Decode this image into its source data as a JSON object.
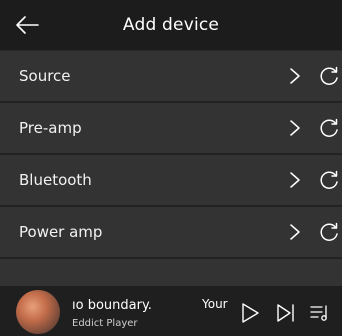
{
  "header": {
    "title": "Add device",
    "back_icon": "arrow-left-icon"
  },
  "devices": [
    {
      "label": "Source"
    },
    {
      "label": "Pre-amp"
    },
    {
      "label": "Bluetooth"
    },
    {
      "label": "Power amp"
    }
  ],
  "player": {
    "song": "ıo boundary.",
    "artist": "Eddict Player",
    "next_text": "Your",
    "controls": [
      "play-icon",
      "skip-next-icon",
      "queue-icon"
    ]
  },
  "colors": {
    "background": "#2a2a2a",
    "header": "#1c1c1c",
    "row": "#333333",
    "player": "#1f1f1f",
    "text": "#ffffff"
  }
}
